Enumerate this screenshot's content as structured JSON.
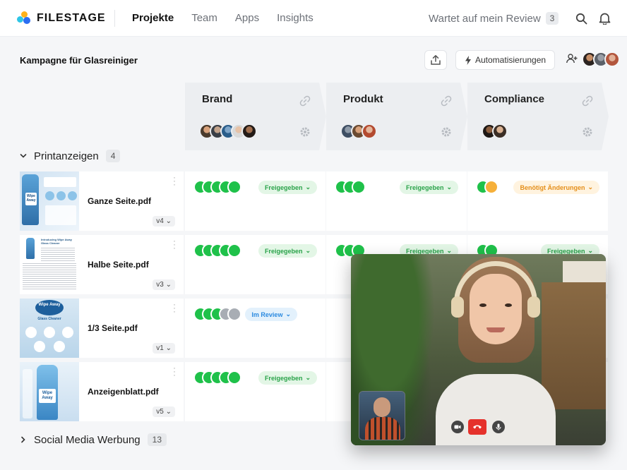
{
  "brand": {
    "name": "FILESTAGE"
  },
  "nav": {
    "items": [
      "Projekte",
      "Team",
      "Apps",
      "Insights"
    ],
    "active": "Projekte"
  },
  "review": {
    "label": "Wartet auf mein Review",
    "count": "3"
  },
  "project": {
    "title": "Kampagne für Glasreiniger",
    "automation_label": "Automatisierungen"
  },
  "steps": [
    {
      "title": "Brand"
    },
    {
      "title": "Produkt"
    },
    {
      "title": "Compliance"
    }
  ],
  "groups": [
    {
      "name": "Printanzeigen",
      "count": "4",
      "expanded": true
    },
    {
      "name": "Social Media Werbung",
      "count": "13",
      "expanded": false
    }
  ],
  "files": [
    {
      "name": "Ganze Seite.pdf",
      "version": "v4",
      "cells": [
        {
          "status": "Freigegeben",
          "tone": "green"
        },
        {
          "status": "Freigegeben",
          "tone": "green"
        },
        {
          "status": "Benötigt Änderungen",
          "tone": "orange"
        }
      ]
    },
    {
      "name": "Halbe Seite.pdf",
      "version": "v3",
      "cells": [
        {
          "status": "Freigegeben",
          "tone": "green"
        },
        {
          "status": "Freigegeben",
          "tone": "green"
        },
        {
          "status": "Freigegeben",
          "tone": "green"
        }
      ]
    },
    {
      "name": "1/3 Seite.pdf",
      "version": "v1",
      "cells": [
        {
          "status": "Im Review",
          "tone": "blue"
        }
      ]
    },
    {
      "name": "Anzeigenblatt.pdf",
      "version": "v5",
      "cells": [
        {
          "status": "Freigegeben",
          "tone": "green"
        }
      ]
    }
  ],
  "thumbnail_text": {
    "wipe_away": "Wipe Away",
    "glass_cleaner": "Glass Cleaner",
    "introducing": "Introducing Wipe Away Glass Cleaner"
  },
  "colors": {
    "approved": "#1fc14a",
    "pending": "#a8adb4",
    "changes": "#f6b03a",
    "accent": "#2b6ef2",
    "hangup": "#e5312b"
  },
  "icons": [
    "search-icon",
    "bell-icon",
    "upload-icon",
    "lightning-icon",
    "add-user-icon",
    "link-icon",
    "gear-icon",
    "chevron-down-icon",
    "chevron-right-icon",
    "kebab-icon",
    "camera-icon",
    "hangup-icon",
    "mic-icon"
  ]
}
